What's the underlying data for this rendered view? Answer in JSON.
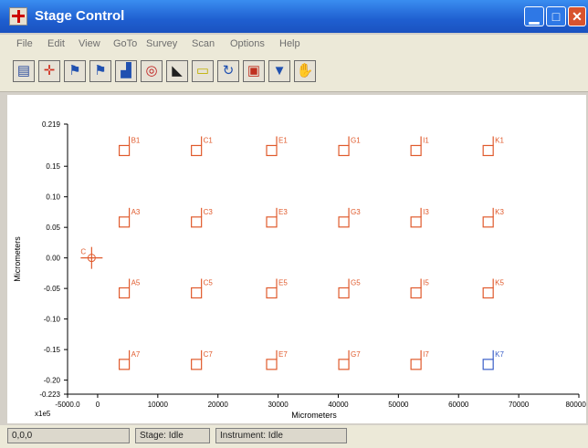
{
  "window": {
    "title": "Stage Control"
  },
  "menu": [
    "File",
    "Edit",
    "View",
    "GoTo",
    "Survey",
    "Scan",
    "Options",
    "Help"
  ],
  "toolbar": [
    {
      "name": "open-file-icon",
      "glyph": "▤",
      "color": "#3050a0"
    },
    {
      "name": "crosshair-move-icon",
      "glyph": "✛",
      "color": "#d03020"
    },
    {
      "name": "add-flag-icon",
      "glyph": "⚑",
      "color": "#2050b0"
    },
    {
      "name": "flag-list-icon",
      "glyph": "⚑",
      "color": "#2050b0"
    },
    {
      "name": "chart-icon",
      "glyph": "▟",
      "color": "#2050b0"
    },
    {
      "name": "stage-wheel-icon",
      "glyph": "◎",
      "color": "#c02020"
    },
    {
      "name": "boot-icon",
      "glyph": "◣",
      "color": "#202020"
    },
    {
      "name": "scan-image-icon",
      "glyph": "▭",
      "color": "#c0b000"
    },
    {
      "name": "refresh-icon",
      "glyph": "↻",
      "color": "#2050b0"
    },
    {
      "name": "record-icon",
      "glyph": "▣",
      "color": "#c03020"
    },
    {
      "name": "filter-icon",
      "glyph": "▼",
      "color": "#2050b0"
    },
    {
      "name": "stop-hand-icon",
      "glyph": "✋",
      "color": "#c02020"
    }
  ],
  "chart_data": {
    "type": "scatter",
    "title": "",
    "xlabel": "Micrometers",
    "ylabel": "Micrometers",
    "exponent_label": "x1e5",
    "xlim": [
      -5000,
      80000
    ],
    "ylim": [
      -0.223,
      0.219
    ],
    "x_ticks": [
      "-5000.0",
      "0",
      "10000",
      "20000",
      "30000",
      "40000",
      "50000",
      "60000",
      "70000",
      "80000.0"
    ],
    "x_tick_values": [
      -5000,
      0,
      10000,
      20000,
      30000,
      40000,
      50000,
      60000,
      70000,
      80000
    ],
    "y_ticks": [
      "0.219",
      "0.15",
      "0.10",
      "0.05",
      "0.00",
      "-0.05",
      "-0.10",
      "-0.15",
      "-0.20",
      "-0.223"
    ],
    "y_tick_values": [
      0.219,
      0.15,
      0.1,
      0.05,
      0.0,
      -0.05,
      -0.1,
      -0.15,
      -0.2,
      -0.223
    ],
    "points": [
      {
        "x": 4500,
        "y": 0.175,
        "label": "B1",
        "color": "#e05a2c"
      },
      {
        "x": 16500,
        "y": 0.175,
        "label": "C1",
        "color": "#e05a2c"
      },
      {
        "x": 29000,
        "y": 0.175,
        "label": "E1",
        "color": "#e05a2c"
      },
      {
        "x": 41000,
        "y": 0.175,
        "label": "G1",
        "color": "#e05a2c"
      },
      {
        "x": 53000,
        "y": 0.175,
        "label": "I1",
        "color": "#e05a2c"
      },
      {
        "x": 65000,
        "y": 0.175,
        "label": "K1",
        "color": "#e05a2c"
      },
      {
        "x": 4500,
        "y": 0.058,
        "label": "A3",
        "color": "#e05a2c"
      },
      {
        "x": 16500,
        "y": 0.058,
        "label": "C3",
        "color": "#e05a2c"
      },
      {
        "x": 29000,
        "y": 0.058,
        "label": "E3",
        "color": "#e05a2c"
      },
      {
        "x": 41000,
        "y": 0.058,
        "label": "G3",
        "color": "#e05a2c"
      },
      {
        "x": 53000,
        "y": 0.058,
        "label": "I3",
        "color": "#e05a2c"
      },
      {
        "x": 65000,
        "y": 0.058,
        "label": "K3",
        "color": "#e05a2c"
      },
      {
        "x": 4500,
        "y": -0.058,
        "label": "A5",
        "color": "#e05a2c"
      },
      {
        "x": 16500,
        "y": -0.058,
        "label": "C5",
        "color": "#e05a2c"
      },
      {
        "x": 29000,
        "y": -0.058,
        "label": "E5",
        "color": "#e05a2c"
      },
      {
        "x": 41000,
        "y": -0.058,
        "label": "G5",
        "color": "#e05a2c"
      },
      {
        "x": 53000,
        "y": -0.058,
        "label": "I5",
        "color": "#e05a2c"
      },
      {
        "x": 65000,
        "y": -0.058,
        "label": "K5",
        "color": "#e05a2c"
      },
      {
        "x": 4500,
        "y": -0.175,
        "label": "A7",
        "color": "#e05a2c"
      },
      {
        "x": 16500,
        "y": -0.175,
        "label": "C7",
        "color": "#e05a2c"
      },
      {
        "x": 29000,
        "y": -0.175,
        "label": "E7",
        "color": "#e05a2c"
      },
      {
        "x": 41000,
        "y": -0.175,
        "label": "G7",
        "color": "#e05a2c"
      },
      {
        "x": 53000,
        "y": -0.175,
        "label": "I7",
        "color": "#e05a2c"
      },
      {
        "x": 65000,
        "y": -0.175,
        "label": "K7",
        "color": "#3a5fc8"
      }
    ],
    "cursor": {
      "x": -1000,
      "y": 0.0,
      "label": "C",
      "color": "#e05a2c"
    }
  },
  "status": {
    "coords": "0,0,0",
    "stage": "Stage: Idle",
    "instrument": "Instrument: Idle"
  }
}
